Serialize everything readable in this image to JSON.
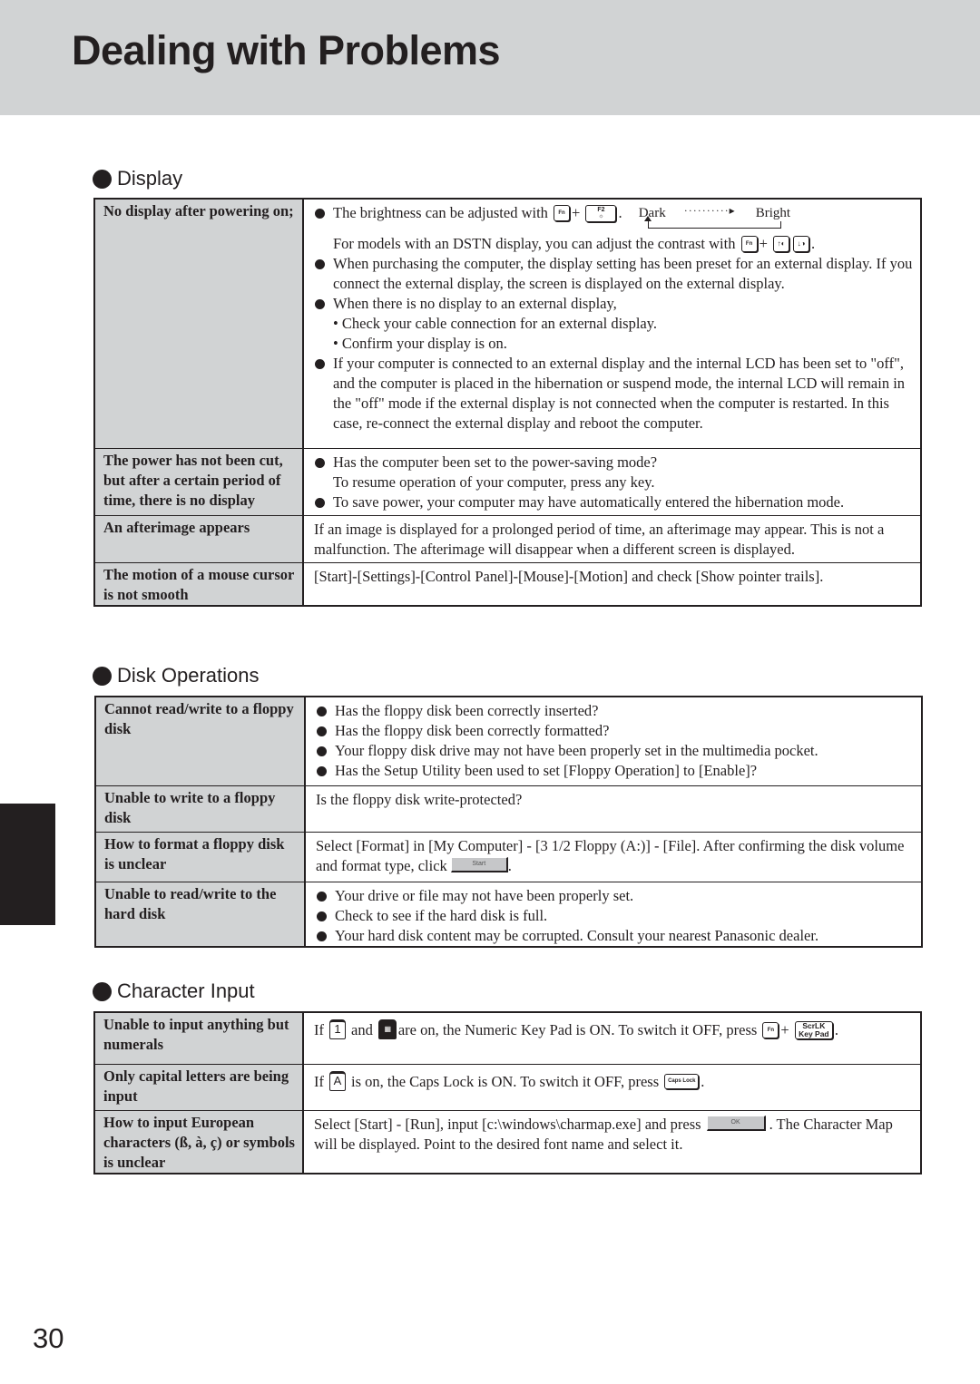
{
  "page": {
    "title": "Dealing with Problems",
    "page_number": "30"
  },
  "sections": {
    "display": {
      "heading": "Display",
      "rows": [
        {
          "problem": "No display after powering on;",
          "brightness": {
            "text": "The brightness can be adjusted with",
            "plus": "+",
            "period": ".",
            "key_fn": "Fn",
            "key_f2": "F2",
            "key_f2_sub": "☼",
            "scale_dark": "Dark",
            "scale_dots": "··········▸",
            "scale_bright": "Bright"
          },
          "contrast": {
            "text": "For models with an DSTN display, you can adjust the contrast with",
            "plus": "+",
            "period": ".",
            "key_fn": "Fn",
            "key_up": "↑◐",
            "key_down": "↓◑"
          },
          "bullet_preset": "When purchasing the computer, the display setting has been preset for an external display.  If you connect the external display, the screen is displayed on the external display.",
          "bullet_no_display": "When there is no display to an external display,",
          "sub_items": [
            "• Check your cable connection for an external display.",
            "• Confirm your display is on."
          ],
          "bullet_lcd_off": "If your computer is connected to an external display and the internal LCD has been set to \"off\", and the computer is placed in the hibernation or suspend mode, the internal LCD will remain in the \"off\" mode if the external display is not connected when the computer is restarted. In this case, re-connect the external display and reboot the computer."
        },
        {
          "problem": "The power has not been cut, but after a certain period of time, there is no display",
          "bullet1": "Has the computer been set to the power-saving mode?",
          "bullet1_cont": "To resume operation of your computer, press any key.",
          "bullet2": "To save power, your computer may have automatically entered  the hibernation mode."
        },
        {
          "problem": "An afterimage appears",
          "solution": "If an image is displayed for a prolonged period of time, an afterimage may appear. This is not a malfunction. The afterimage will disappear when a different screen is displayed."
        },
        {
          "problem": "The motion of a mouse cursor is not smooth",
          "solution": "[Start]-[Settings]-[Control Panel]-[Mouse]-[Motion] and check [Show pointer trails]."
        }
      ]
    },
    "disk": {
      "heading": "Disk Operations",
      "rows": [
        {
          "problem": "Cannot read/write to a floppy disk",
          "bullets": [
            "Has the floppy disk been correctly inserted?",
            "Has the floppy disk been correctly formatted?",
            "Your floppy disk drive may not have been properly set in the multimedia pocket.",
            "Has the Setup Utility been used to set [Floppy Operation] to [Enable]?"
          ]
        },
        {
          "problem": "Unable to write to a floppy disk",
          "solution": "Is the floppy disk write-protected?"
        },
        {
          "problem": "How to format a floppy disk is unclear",
          "solution": "Select [Format] in [My Computer] - [3 1/2 Floppy (A:)] - [File].  After confirming the disk volume and format type, click",
          "button_label": "Start",
          "end": "."
        },
        {
          "problem": "Unable to read/write to the hard disk",
          "bullets": [
            "Your drive or file may not have been properly set.",
            "Check to see if the hard disk is full.",
            "Your hard disk content may be corrupted.  Consult your nearest Panasonic dealer."
          ]
        }
      ]
    },
    "char": {
      "heading": "Character Input",
      "rows": [
        {
          "problem": "Unable to input anything but numerals",
          "if": "If",
          "and": "and",
          "icon_num": "1",
          "icon_keypad": "▦",
          "text": "are on, the Numeric Key Pad is ON.  To switch it OFF, press",
          "plus": "+",
          "key_fn": "Fn",
          "key_scrlk_top": "ScrLK",
          "key_scrlk_bottom": "Key Pad",
          "end": "."
        },
        {
          "problem": "Only capital letters are being input",
          "if": "If",
          "icon_caps": "A",
          "text": "is on, the Caps Lock is ON.  To switch it OFF, press",
          "key_caps": "Caps Lock",
          "end": "."
        },
        {
          "problem": "How to input European characters (ß, à, ç) or symbols is unclear",
          "text1": "Select [Start] - [Run],  input [c:\\windows\\charmap.exe] and press",
          "button_label": "OK",
          "text2": ". The Character Map will be displayed.  Point to the desired font name and select it."
        }
      ]
    }
  }
}
